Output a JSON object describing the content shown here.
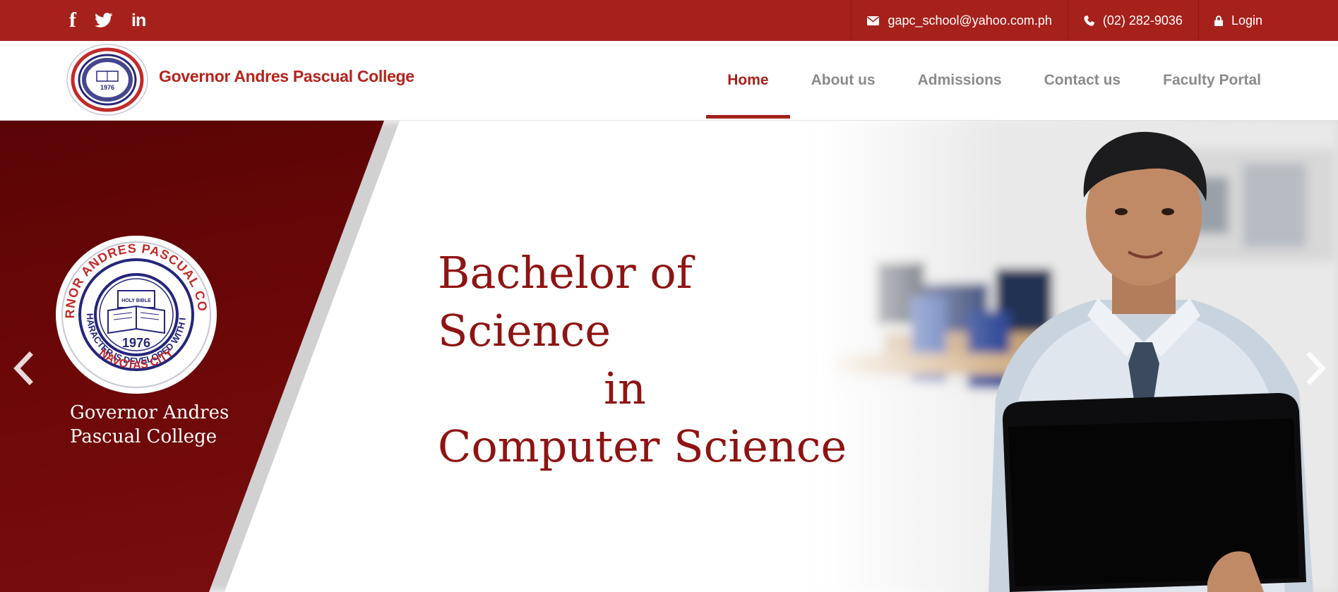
{
  "topbar": {
    "social": [
      {
        "icon": "facebook-icon",
        "glyph": "f"
      },
      {
        "icon": "twitter-icon",
        "glyph": ""
      },
      {
        "icon": "linkedin-icon",
        "glyph": "in"
      }
    ],
    "email": "gapc_school@yahoo.com.ph",
    "phone": "(02) 282-9036",
    "login": "Login"
  },
  "brand": {
    "name": "Governor Andres Pascual College",
    "seal_outer_text": "GOVERNOR ANDRES PASCUAL COLLEGE",
    "seal_inner_text": "WHERE CHARACTER IS DEVELOPED WITH INTELLECT",
    "seal_bottom_text": "NAVOTAS CITY",
    "seal_book": "HOLY BIBLE",
    "seal_year": "1976"
  },
  "nav": {
    "items": [
      "Home",
      "About us",
      "Admissions",
      "Contact us",
      "Faculty Portal"
    ],
    "active": "Home"
  },
  "hero": {
    "panel_name_line1": "Governor Andres",
    "panel_name_line2": "Pascual College",
    "headline_line1": "Bachelor of Science",
    "headline_line2": "in",
    "headline_line3": "Computer Science"
  },
  "colors": {
    "brand_red": "#a6211c",
    "panel_maroon": "#6b0708",
    "headline": "#8e1413",
    "nav_inactive": "#8a8a8a"
  }
}
